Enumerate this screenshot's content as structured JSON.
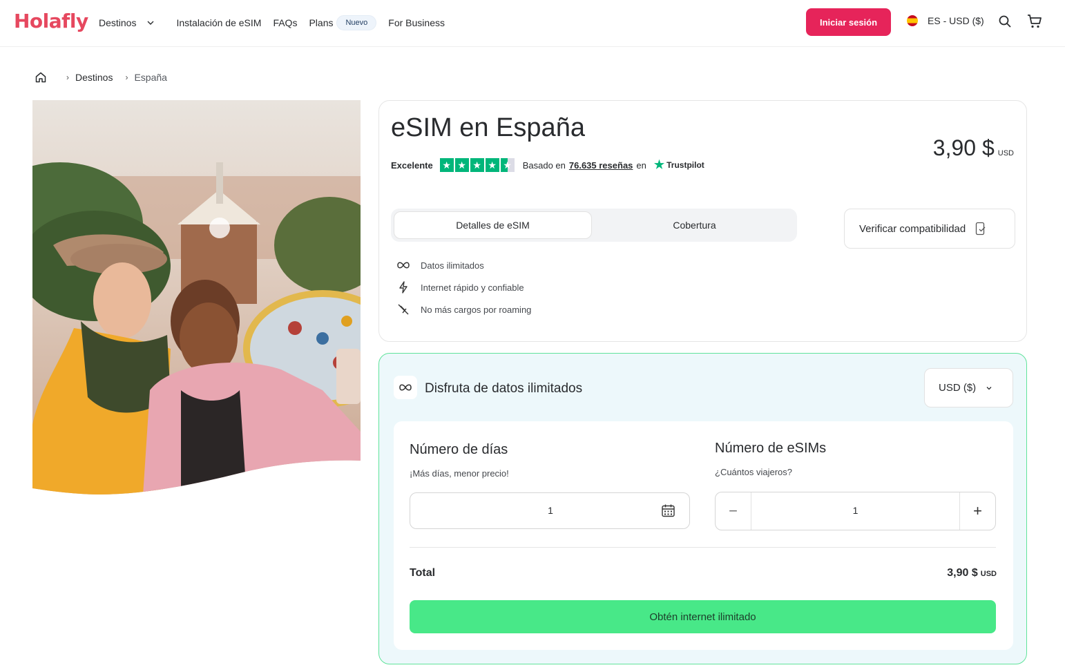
{
  "header": {
    "logo": "Holafly",
    "nav": {
      "destinos": "Destinos",
      "install": "Instalación de eSIM",
      "faqs": "FAQs",
      "plans": "Plans",
      "plans_badge": "Nuevo",
      "business": "For Business"
    },
    "login_label": "Iniciar sesión",
    "lang_label": "ES - USD ($)"
  },
  "breadcrumb": {
    "items": [
      "Destinos",
      "España"
    ]
  },
  "hero": {
    "alt": "Dos viajeras sonriendo en Park Güell, Barcelona"
  },
  "product": {
    "title": "eSIM en España",
    "price_value": "3,90 $",
    "price_currency": "USD",
    "rating": {
      "label": "Excelente",
      "stars": 4.5,
      "based_on": "Basado en",
      "reviews_link": "76.635 reseñas",
      "in": "en",
      "provider": "Trustpilot"
    },
    "tabs": [
      "Detalles de eSIM",
      "Cobertura"
    ],
    "verify_label": "Verificar compatibilidad",
    "features": [
      {
        "icon": "infinity-icon",
        "label": "Datos ilimitados"
      },
      {
        "icon": "lightning-icon",
        "label": "Internet rápido y confiable"
      },
      {
        "icon": "no-roaming-icon",
        "label": "No más cargos por roaming"
      }
    ]
  },
  "plan": {
    "title": "Disfruta de datos ilimitados",
    "currency_select": "USD ($)",
    "days": {
      "title": "Número de días",
      "subtitle": "¡Más días, menor precio!",
      "value": "1"
    },
    "esims": {
      "title": "Número de eSIMs",
      "subtitle": "¿Cuántos viajeros?",
      "value": "1",
      "minus": "−",
      "plus": "+"
    },
    "total_label": "Total",
    "total_value": "3,90 $",
    "total_currency": "USD",
    "cta_label": "Obtén internet ilimitado"
  },
  "colors": {
    "brand": "#e6245a",
    "cta": "#48e888",
    "trustpilot": "#00b67a",
    "plan_border": "#5fe39a",
    "plan_bg": "#edf8fb"
  }
}
